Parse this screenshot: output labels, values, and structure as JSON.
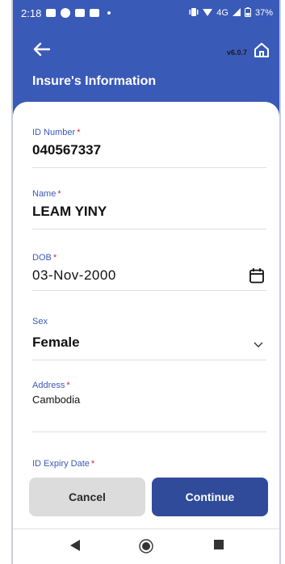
{
  "status_bar": {
    "time": "2:18",
    "network": "4G",
    "battery": "37%"
  },
  "app": {
    "version": "v6.0.7",
    "title": "Insure's Information"
  },
  "form": {
    "id_number": {
      "label": "ID Number",
      "value": "040567337"
    },
    "name": {
      "label": "Name",
      "value": "LEAM YINY"
    },
    "dob": {
      "label": "DOB",
      "value": "03-Nov-2000"
    },
    "sex": {
      "label": "Sex",
      "value": "Female"
    },
    "address": {
      "label": "Address",
      "value": "Cambodia"
    },
    "id_expiry": {
      "label": "ID Expiry Date"
    },
    "required_mark": "*"
  },
  "actions": {
    "cancel_label": "Cancel",
    "continue_label": "Continue"
  },
  "colors": {
    "brand": "#3a5ab8",
    "primary_button": "#2f4b9a",
    "required": "#d0283a"
  }
}
